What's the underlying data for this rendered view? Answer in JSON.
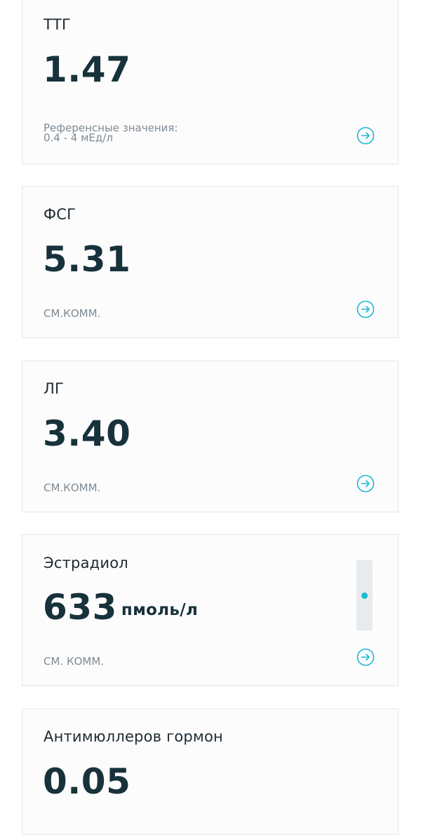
{
  "colors": {
    "accent": "#1cb8d6",
    "value_text": "#18323b",
    "note_text": "#7e8a92",
    "card_border": "#e4e6e8"
  },
  "cards": [
    {
      "title": "ТТГ",
      "value": "1.47",
      "unit": "",
      "note_line1": "Референсные значения:",
      "note_line2": "0.4 - 4 мЕд/л",
      "action_icon": "arrow-right-circle-icon"
    },
    {
      "title": "ФСГ",
      "value": "5.31",
      "unit": "",
      "note_line1": "СМ.КОММ.",
      "action_icon": "arrow-right-circle-icon"
    },
    {
      "title": "ЛГ",
      "value": "3.40",
      "unit": "",
      "note_line1": "СМ.КОММ.",
      "action_icon": "arrow-right-circle-icon"
    },
    {
      "title": "Эстрадиол",
      "value": "633",
      "unit": "пмоль/л",
      "note_line1": "СМ. КОММ.",
      "action_icon": "arrow-right-circle-icon",
      "range_indicator_position": 0.5
    },
    {
      "title": "Антимюллеров гормон",
      "value": "0.05",
      "unit": ""
    }
  ]
}
